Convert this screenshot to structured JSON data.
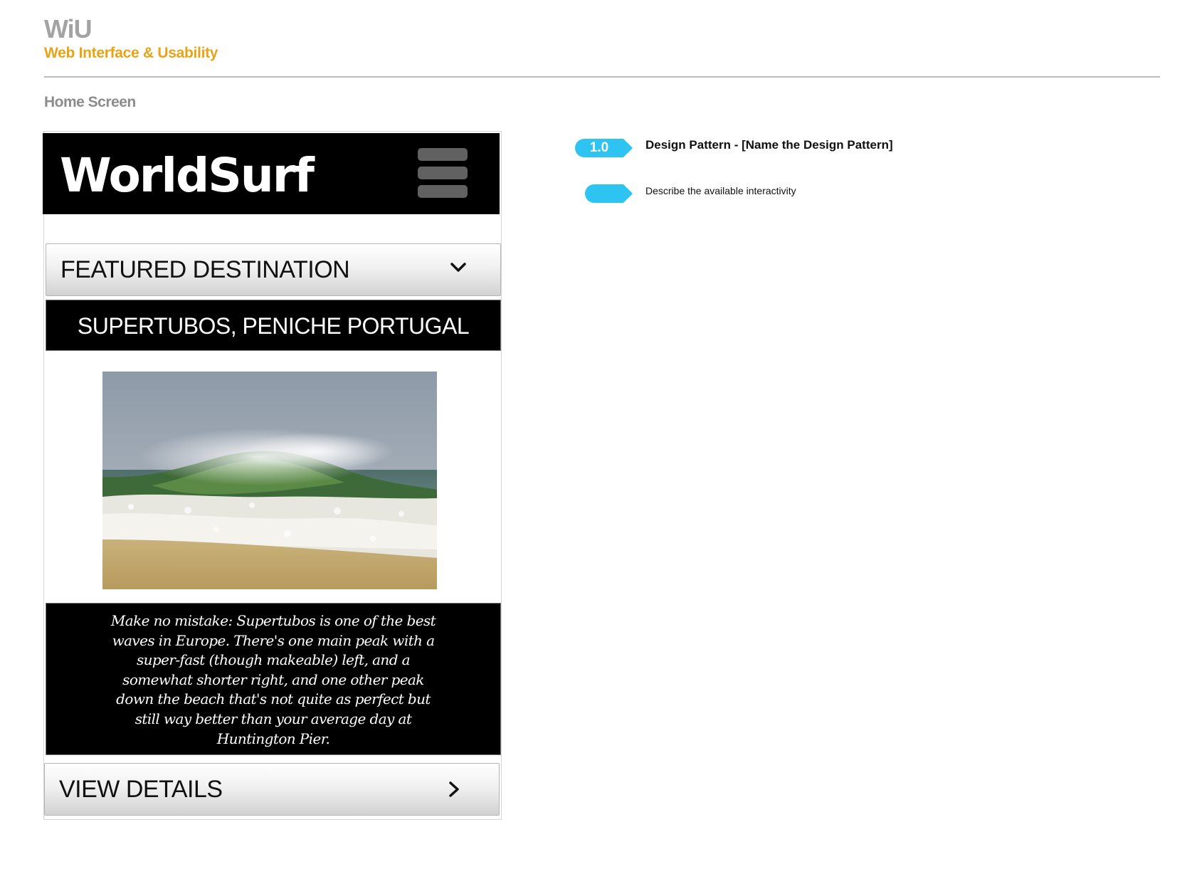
{
  "doc": {
    "brand": "WiU",
    "subtitle": "Web Interface & Usability",
    "screen_title": "Home Screen",
    "colors": {
      "brand_gray": "#a3a3a3",
      "subtitle_orange": "#e8a317",
      "badge_blue": "#2ec4f2"
    }
  },
  "app": {
    "logo": "WorldSurf",
    "menu_icon": "hamburger-icon",
    "featured_label": "FEATURED DESTINATION",
    "featured_icon": "chevron-down-icon",
    "destination_title": "SUPERTUBOS, PENICHE PORTUGAL",
    "photo_subject": "breaking-wave-photo",
    "description": "Make no mistake: Supertubos is one of the best waves in Europe. There's one main peak with a super-fast (though makeable) left, and a somewhat shorter right, and one other peak down the beach that's not quite as perfect but still way better than your average day at Huntington Pier.",
    "view_details_label": "VIEW DETAILS",
    "view_details_icon": "chevron-right-icon"
  },
  "annotations": [
    {
      "number": "1.0",
      "text": "Design Pattern - [Name the Design Pattern]"
    },
    {
      "number": "",
      "text": "Describe the available interactivity"
    }
  ]
}
